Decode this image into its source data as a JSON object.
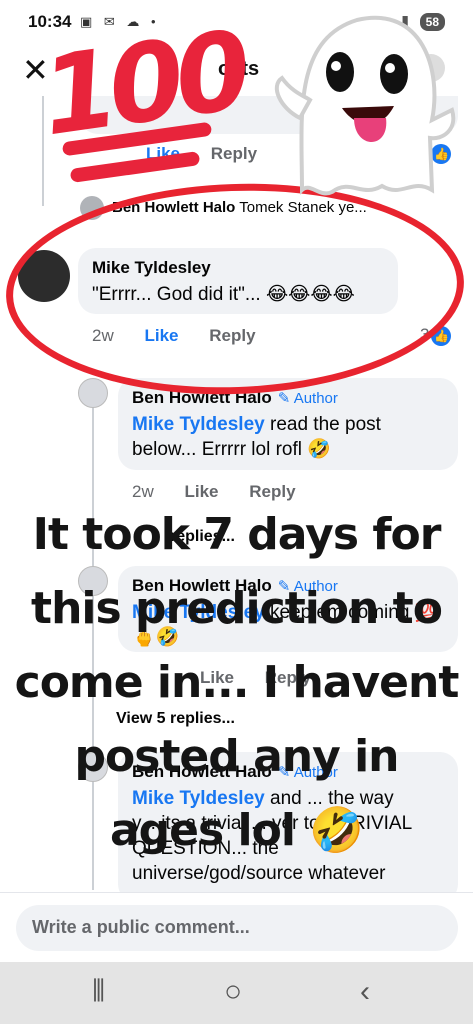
{
  "status": {
    "time": "10:34",
    "battery": "58"
  },
  "header": {
    "title_partial": "osts"
  },
  "overlay": {
    "lines": [
      "It took 7 days for",
      "this prediction to",
      "come in... I havent",
      "posted any in",
      "ages lol 🤣"
    ]
  },
  "sticker": {
    "text": "100"
  },
  "prev_comment": {
    "like": "Like",
    "reply": "Reply",
    "reactions": "2"
  },
  "collapsed_comment": {
    "author": "Ben Howlett Halo",
    "text": "Tomek Stanek ye..."
  },
  "main_comment": {
    "author": "Mike Tyldesley",
    "text": "\"Errrr... God did it\"... 😂😂😂😂",
    "time": "2w",
    "like": "Like",
    "reply": "Reply",
    "reactions": "3"
  },
  "reply1": {
    "author": "Ben Howlett Halo",
    "badge": "✎ Author",
    "mention": "Mike Tyldesley",
    "text": " read the post below... Errrrr lol rofl 🤣",
    "time": "2w",
    "like": "Like",
    "reply": "Reply"
  },
  "view_replies_1": "replies...",
  "reply2": {
    "author": "Ben Howlett Halo",
    "badge": "✎ Author",
    "mention": "Mike Tyldesley",
    "text": " keep em coming 💯🖕🤣",
    "like": "Like",
    "reply": "Reply"
  },
  "view_replies_2": "View 5 replies...",
  "reply3": {
    "author": "Ben Howlett Halo",
    "badge": "✎ Author",
    "mention": "Mike Tyldesley",
    "text_1": " and ... the way",
    "text_2": "y... its a trivial ... ver to A TRIVIAL QUESTION... the universe/god/source whatever"
  },
  "composer": {
    "placeholder": "Write a public comment..."
  },
  "colors": {
    "accent": "#1877f2",
    "annotation": "#e8242f",
    "bubble": "#f0f2f5"
  }
}
